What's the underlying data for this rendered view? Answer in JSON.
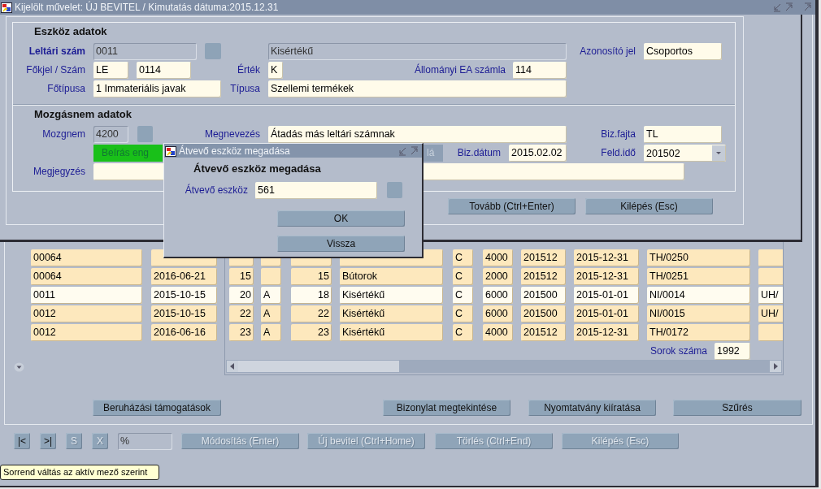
{
  "window": {
    "title": "Kijelölt művelet: ÚJ BEVITEL / Kimutatás dátuma:2015.12.31"
  },
  "asset_dialog": {
    "section_1": "Eszköz adatok",
    "inventory_number": {
      "label": "Leltári szám",
      "value": "0011",
      "readonly": true
    },
    "category": {
      "value": "Kisértékű",
      "readonly": true
    },
    "identifier": {
      "label": "Azonosító jel",
      "value": "Csoportos",
      "readonly": false
    },
    "main_code": {
      "label": "Főkjel / Szám",
      "prefix": "LE",
      "number": "0114"
    },
    "value_code": {
      "label": "Érték",
      "value": "K",
      "readonly": false
    },
    "ea_account": {
      "label": "Állományi EA számla",
      "value": "114",
      "readonly": false
    },
    "main_type": {
      "label": "Főtípusa",
      "value": "1 Immateriális javak",
      "readonly": false
    },
    "type": {
      "label": "Típusa",
      "value": "Szellemi termékek",
      "readonly": false
    },
    "section_2": "Mozgásnem adatok",
    "movement_code": {
      "label": "Mozgnem",
      "value": "4200",
      "readonly": true
    },
    "name": {
      "label": "Megnevezés",
      "value": "Átadás más leltári számnak",
      "readonly": false
    },
    "doc_type": {
      "label": "Biz.fajta",
      "value": "TL",
      "readonly": false
    },
    "status_badge": "Beírás eng",
    "partial_label": "lá",
    "doc_date": {
      "label": "Biz.dátum",
      "value": "2015.02.02",
      "readonly": false
    },
    "posting_period": {
      "label": "Feld.idő",
      "value": "201502"
    },
    "note": {
      "label": "Megjegyzés"
    },
    "buttons": [
      "Tovább (Ctrl+Enter)",
      "Kilépés (Esc)"
    ]
  },
  "transfer_dialog": {
    "title": "Átvevő eszköz megadása",
    "heading": "Átvevő eszköz megadása",
    "field": {
      "label": "Átvevő eszköz",
      "value": "561"
    },
    "buttons": [
      "OK",
      "Vissza"
    ]
  },
  "table": {
    "rows": [
      {
        "selected": false,
        "cells": [
          "00064",
          null,
          null,
          null,
          null,
          null,
          "C",
          "4000",
          "201512",
          "2015-12-31",
          "TH/0250",
          null
        ]
      },
      {
        "selected": false,
        "cells": [
          "00064",
          "2016-06-21",
          "15",
          null,
          "15",
          "Bútorok",
          "C",
          "2000",
          "201512",
          "2015-12-31",
          "TH/0251",
          null
        ]
      },
      {
        "selected": true,
        "cells": [
          "0011",
          "2015-10-15",
          "20",
          "A",
          "18",
          "Kisértékű",
          "C",
          "6000",
          "201500",
          "2015-01-01",
          "NI/0014",
          "UH/"
        ]
      },
      {
        "selected": false,
        "cells": [
          "0012",
          "2015-10-15",
          "22",
          "A",
          "22",
          "Kisértékű",
          "C",
          "6000",
          "201500",
          "2015-01-01",
          "NI/0015",
          "UH/"
        ]
      },
      {
        "selected": false,
        "cells": [
          "0012",
          "2016-06-16",
          "23",
          "A",
          "23",
          "Kisértékű",
          "C",
          "4000",
          "201512",
          "2015-12-31",
          "TH/0172",
          null
        ]
      }
    ]
  },
  "row_count": {
    "label": "Sorok száma",
    "value": "1992"
  },
  "action_buttons": [
    "Beruházási támogatások",
    "Bizonylat megtekintése",
    "Nyomtatvány kiíratása",
    "Szűrés"
  ],
  "toolbar": [
    {
      "kind": "button",
      "label": "|<",
      "disabled": false
    },
    {
      "kind": "button",
      "label": ">|",
      "disabled": false
    },
    {
      "kind": "button",
      "label": "S",
      "disabled": true
    },
    {
      "kind": "button",
      "label": "X",
      "disabled": true
    },
    {
      "kind": "field",
      "value": "%"
    },
    {
      "kind": "button",
      "label": "Módosítás (Enter)",
      "disabled": true
    },
    {
      "kind": "button",
      "label": "Új bevitel (Ctrl+Home)",
      "disabled": true
    },
    {
      "kind": "button",
      "label": "Törlés (Ctrl+End)",
      "disabled": true
    },
    {
      "kind": "button",
      "label": "Kilépés (Esc)",
      "disabled": true
    }
  ],
  "tooltip": "Sorrend váltás az aktív mező szerint"
}
